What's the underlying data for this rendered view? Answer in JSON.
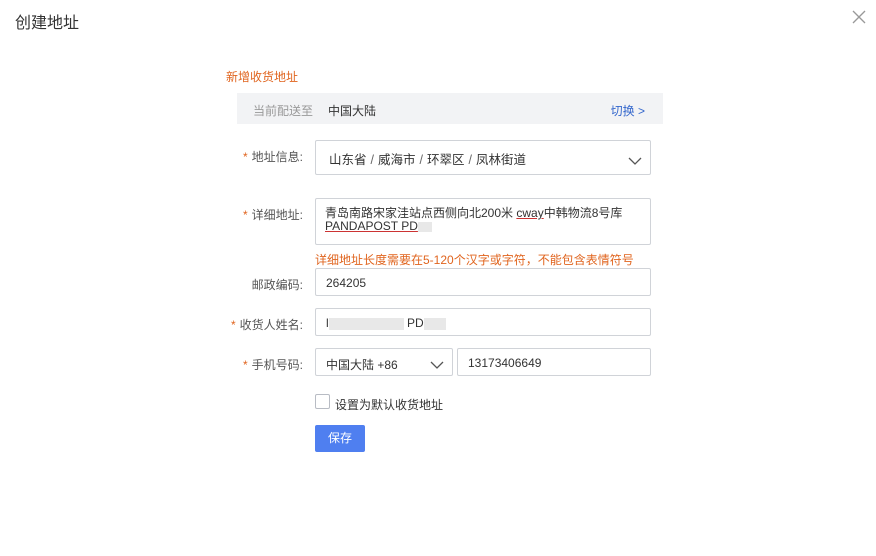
{
  "dialog": {
    "title": "创建地址",
    "close_icon": "close-icon"
  },
  "section": {
    "title": "新增收货地址"
  },
  "region": {
    "label": "当前配送至",
    "value": "中国大陆",
    "switch_label": "切换 >"
  },
  "address_info": {
    "label": "地址信息:",
    "province": "山东省",
    "city": "威海市",
    "district": "环翠区",
    "street": "凤林街道",
    "separator": "/"
  },
  "detail_address": {
    "label": "详细地址:",
    "value_part1": "青岛南路宋家洼站点西侧向北200米 ",
    "value_underlined": "cway",
    "value_part2": "中韩物流8号库",
    "value_line2": "PANDAPOST PD"
  },
  "error": {
    "message": "详细地址长度需要在5-120个汉字或字符，不能包含表情符号"
  },
  "postal": {
    "label": "邮政编码:",
    "value": "264205"
  },
  "recipient": {
    "label": "收货人姓名:",
    "value_prefix": "l",
    "value_mid": "PD"
  },
  "phone": {
    "label": "手机号码:",
    "country_code": "中国大陆 +86",
    "number": "13173406649"
  },
  "default_checkbox": {
    "label": "设置为默认收货地址",
    "checked": false
  },
  "actions": {
    "save_label": "保存"
  },
  "colors": {
    "accent": "#e0641e",
    "link": "#3366cc",
    "primary_button": "#4f7ff0"
  }
}
